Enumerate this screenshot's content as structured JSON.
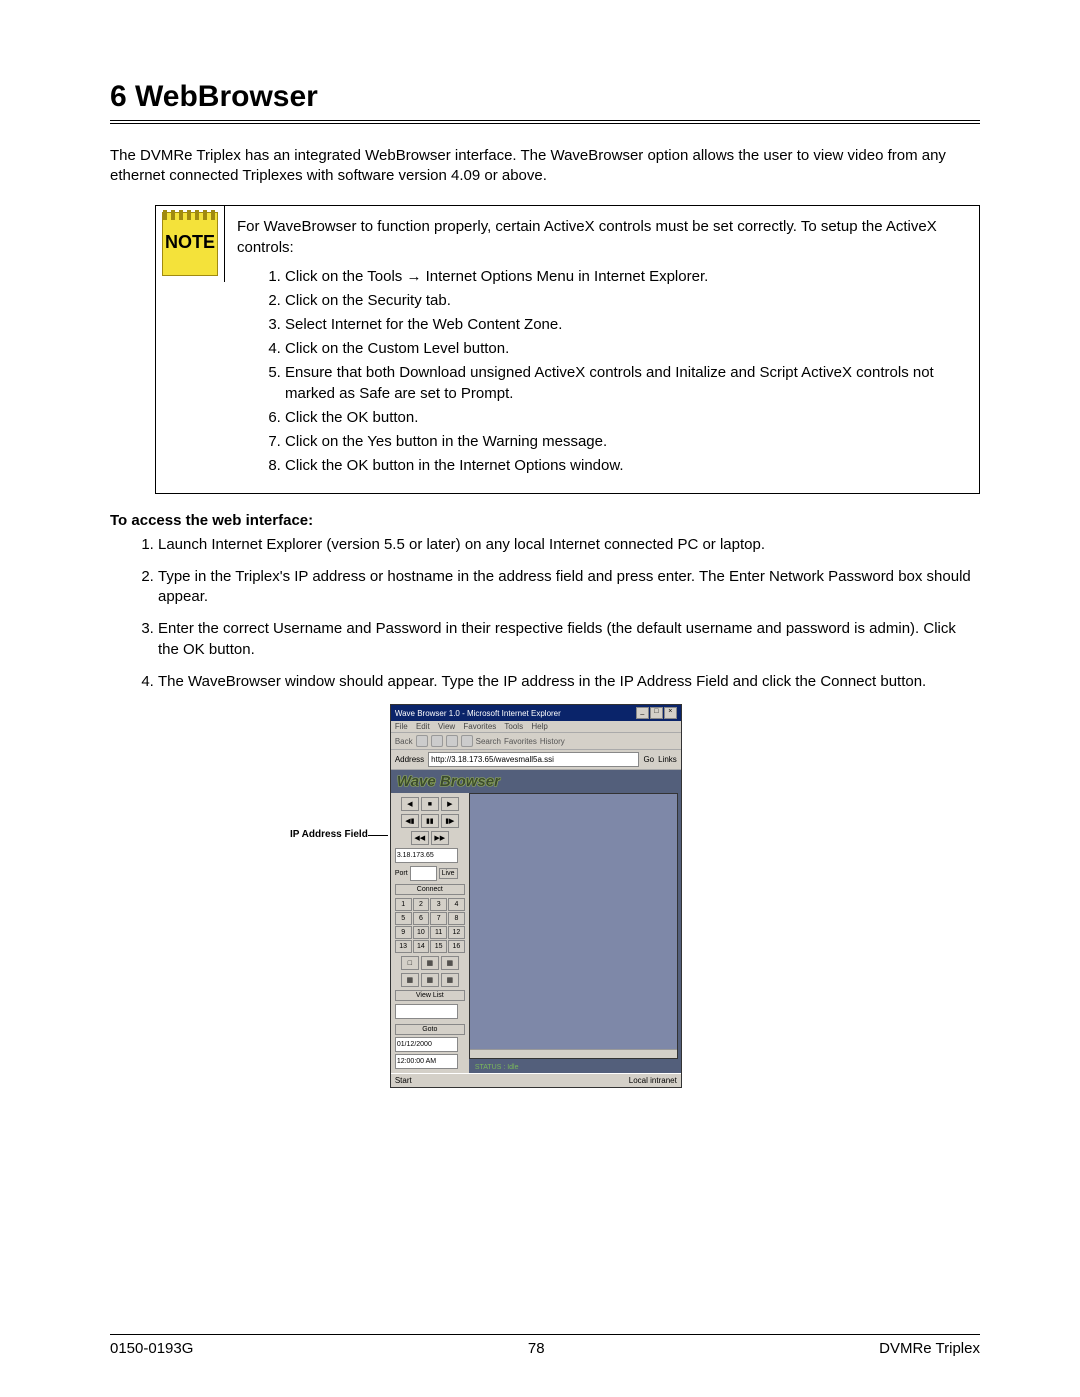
{
  "heading": "6 WebBrowser",
  "intro": "The DVMRe Triplex has an integrated WebBrowser interface. The WaveBrowser option allows the user to view video from any ethernet connected Triplexes with software version 4.09 or above.",
  "note": {
    "icon_label": "NOTE",
    "lead": "For WaveBrowser to function properly, certain ActiveX controls must be set correctly. To setup the ActiveX controls:",
    "steps": [
      "Click on the Tools → Internet Options Menu in Internet Explorer.",
      "Click on the Security tab.",
      "Select Internet for the Web Content Zone.",
      "Click on the Custom Level button.",
      "Ensure that both Download unsigned ActiveX controls and Initalize and Script ActiveX controls not marked as Safe are set to Prompt.",
      "Click the OK button.",
      "Click on the Yes button in the Warning message.",
      "Click the OK button in the Internet Options window."
    ]
  },
  "access_heading": "To access the web interface:",
  "access_steps": [
    "Launch Internet Explorer (version 5.5 or later) on any local Internet connected PC or laptop.",
    "Type in the Triplex's IP address or hostname in the address field and press enter. The Enter Network Password box should appear.",
    "Enter the correct Username and Password in their respective fields (the default username and password is admin). Click the OK button.",
    "The WaveBrowser window should appear. Type the IP address in the IP Address Field and click the Connect button."
  ],
  "figure": {
    "callout": "IP Address Field",
    "ie": {
      "title": "Wave Browser 1.0 - Microsoft Internet Explorer",
      "menu": [
        "File",
        "Edit",
        "View",
        "Favorites",
        "Tools",
        "Help"
      ],
      "toolbar": {
        "back": "Back",
        "search": "Search",
        "favorites": "Favorites",
        "history": "History"
      },
      "address_label": "Address",
      "address_value": "http://3.18.173.65/wavesmall5a.ssi",
      "go": "Go",
      "links": "Links"
    },
    "wave": {
      "banner": "Wave Browser",
      "ip_value": "3.18.173.65",
      "port": "Port",
      "live": "Live",
      "connect": "Connect",
      "numbers": [
        "1",
        "2",
        "3",
        "4",
        "5",
        "6",
        "7",
        "8",
        "9",
        "10",
        "11",
        "12",
        "13",
        "14",
        "15",
        "16"
      ],
      "view_list": "View List",
      "goto": "Goto",
      "date": "01/12/2000",
      "time": "12:00:00 AM",
      "status": "STATUS : Idle",
      "taskbar_start": "Start",
      "taskbar_tray": "Local intranet"
    }
  },
  "footer": {
    "left": "0150-0193G",
    "center": "78",
    "right": "DVMRe Triplex"
  }
}
